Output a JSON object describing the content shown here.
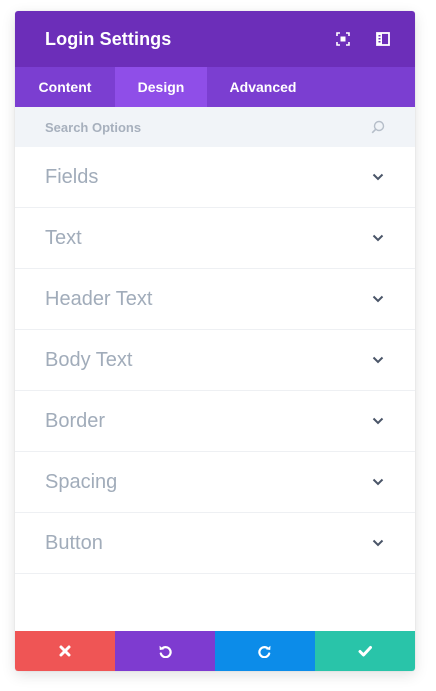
{
  "header": {
    "title": "Login Settings",
    "icons": [
      "expand-icon",
      "sidebar-layout-icon"
    ]
  },
  "tabs": [
    {
      "label": "Content",
      "active": false
    },
    {
      "label": "Design",
      "active": true
    },
    {
      "label": "Advanced",
      "active": false
    }
  ],
  "search": {
    "placeholder": "Search Options",
    "value": ""
  },
  "sections": [
    {
      "label": "Fields"
    },
    {
      "label": "Text"
    },
    {
      "label": "Header Text"
    },
    {
      "label": "Body Text"
    },
    {
      "label": "Border"
    },
    {
      "label": "Spacing"
    },
    {
      "label": "Button"
    }
  ],
  "footer": {
    "buttons": [
      {
        "name": "discard",
        "icon": "close-icon",
        "color": "#ef5555"
      },
      {
        "name": "undo",
        "icon": "undo-icon",
        "color": "#7e3bd0"
      },
      {
        "name": "redo",
        "icon": "redo-icon",
        "color": "#0c8ce9"
      },
      {
        "name": "save",
        "icon": "check-icon",
        "color": "#29c4a9"
      }
    ]
  },
  "colors": {
    "header": "#6c2eb9",
    "tabs": "#7b3ed1",
    "active_tab": "#8f4ee8",
    "search_bg": "#f1f4f8",
    "label": "#a1acba",
    "chevron": "#4a5568"
  }
}
